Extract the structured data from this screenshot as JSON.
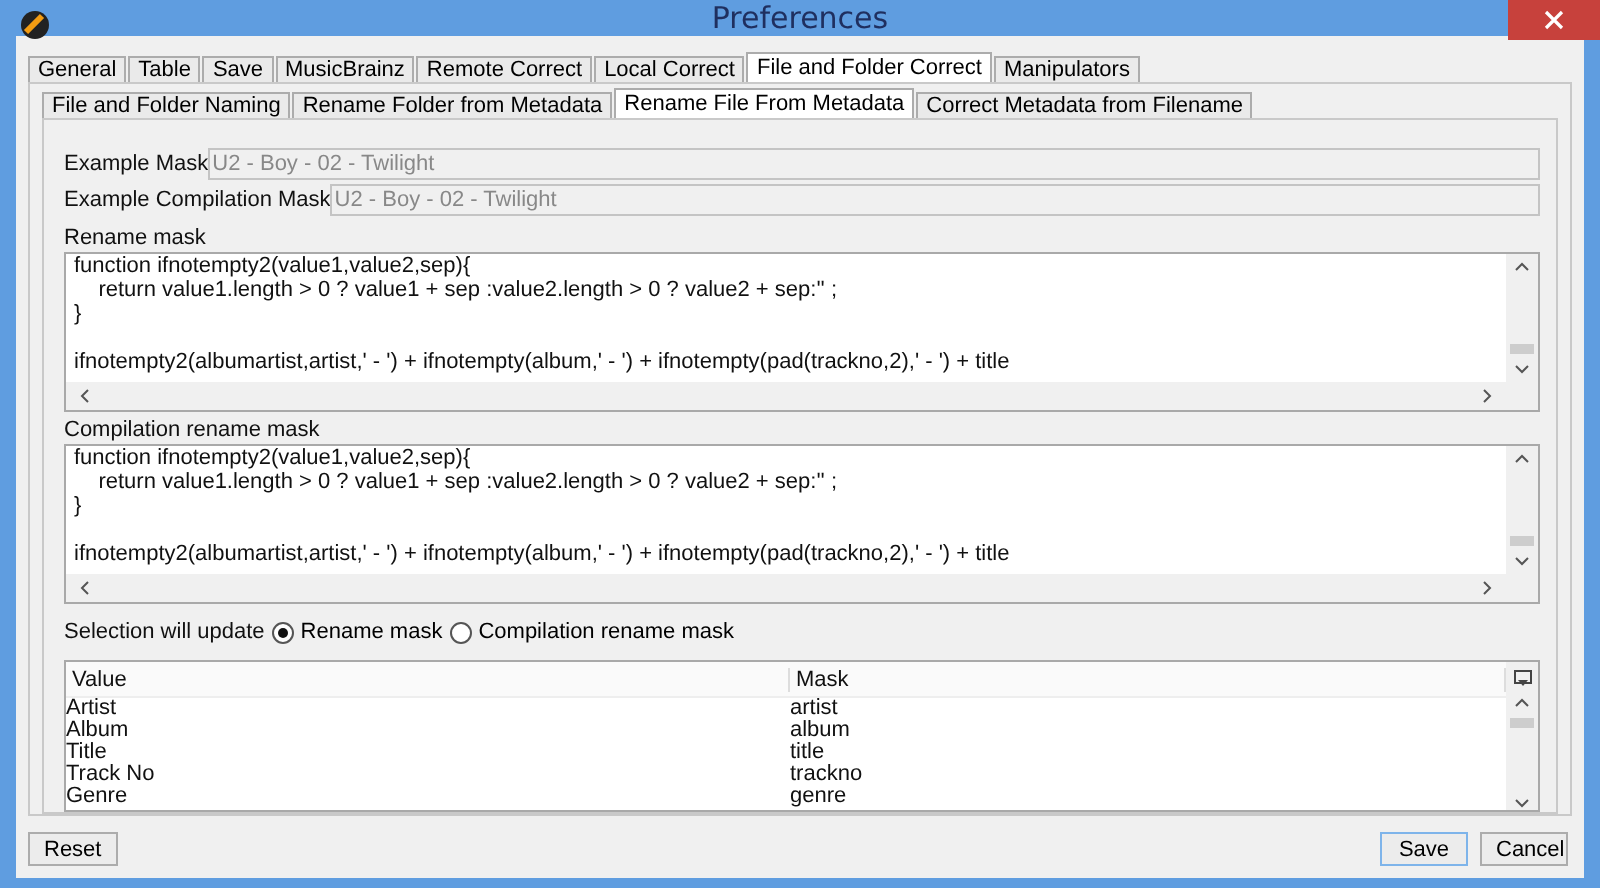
{
  "window": {
    "title": "Preferences"
  },
  "tabs": [
    {
      "label": "General",
      "selected": false
    },
    {
      "label": "Table",
      "selected": false
    },
    {
      "label": "Save",
      "selected": false
    },
    {
      "label": "MusicBrainz",
      "selected": false
    },
    {
      "label": "Remote Correct",
      "selected": false
    },
    {
      "label": "Local Correct",
      "selected": false
    },
    {
      "label": "File and Folder Correct",
      "selected": true
    },
    {
      "label": "Manipulators",
      "selected": false
    }
  ],
  "subtabs": [
    {
      "label": "File and Folder Naming",
      "selected": false
    },
    {
      "label": "Rename Folder from Metadata",
      "selected": false
    },
    {
      "label": "Rename File From Metadata",
      "selected": true
    },
    {
      "label": "Correct Metadata from Filename",
      "selected": false
    }
  ],
  "examples": [
    {
      "label": "Example Mask",
      "value": "U2 - Boy - 02 - Twilight"
    },
    {
      "label": "Example Compilation Mask",
      "value": "U2 - Boy - 02 - Twilight"
    }
  ],
  "masks": [
    {
      "label": "Rename mask",
      "code": "function ifnotempty2(value1,value2,sep){\n    return value1.length > 0 ? value1 + sep :value2.length > 0 ? value2 + sep:'' ;\n}\n\nifnotempty2(albumartist,artist,' - ') + ifnotempty(album,' - ') + ifnotempty(pad(trackno,2),' - ') + title"
    },
    {
      "label": "Compilation rename mask",
      "code": "function ifnotempty2(value1,value2,sep){\n    return value1.length > 0 ? value1 + sep :value2.length > 0 ? value2 + sep:'' ;\n}\n\nifnotempty2(albumartist,artist,' - ') + ifnotempty(album,' - ') + ifnotempty(pad(trackno,2),' - ') + title"
    }
  ],
  "selection": {
    "label": "Selection will update",
    "options": [
      {
        "label": "Rename mask",
        "selected": true
      },
      {
        "label": "Compilation rename mask",
        "selected": false
      }
    ]
  },
  "table": {
    "columns": [
      "Value",
      "Mask"
    ],
    "rows": [
      [
        "Artist",
        "artist"
      ],
      [
        "Album",
        "album"
      ],
      [
        "Title",
        "title"
      ],
      [
        "Track No",
        "trackno"
      ],
      [
        "Genre",
        "genre"
      ]
    ]
  },
  "buttons": {
    "reset": "Reset",
    "save": "Save",
    "cancel": "Cancel"
  }
}
